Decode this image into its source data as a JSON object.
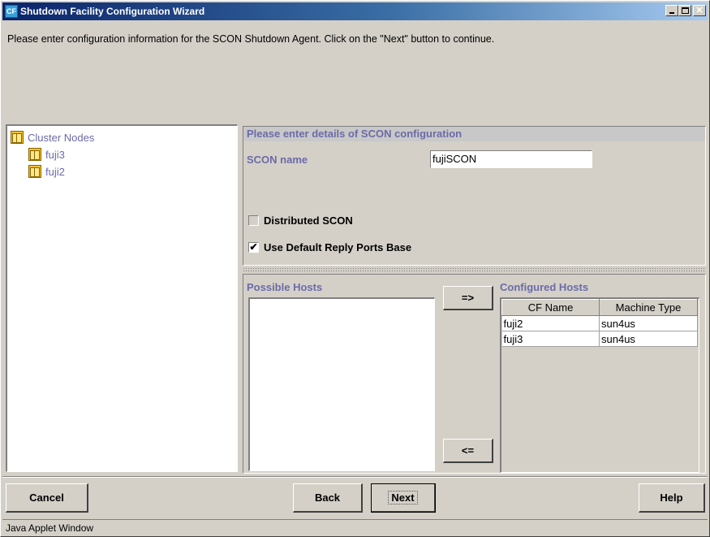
{
  "window": {
    "title": "Shutdown Facility Configuration Wizard",
    "app_icon_text": "CF",
    "minimize_glyph": "_",
    "close_glyph": "✕"
  },
  "instructions": "Please enter configuration information for the SCON Shutdown Agent. Click on the \"Next\" button to continue.",
  "tree": {
    "root_label": "Cluster Nodes",
    "children": [
      "fuji3",
      "fuji2"
    ]
  },
  "scon_config": {
    "header": "Please enter details of SCON configuration",
    "scon_name_label": "SCON name",
    "scon_name_value": "fujiSCON",
    "distributed_label": "Distributed SCON",
    "distributed_checked": false,
    "default_ports_label": "Use Default Reply Ports Base",
    "default_ports_checked": true,
    "check_glyph": "✔"
  },
  "hosts": {
    "possible_label": "Possible Hosts",
    "configured_label": "Configured Hosts",
    "add_button": "=>",
    "remove_button": "<=",
    "columns": [
      "CF Name",
      "Machine Type"
    ],
    "rows": [
      [
        "fuji2",
        "sun4us"
      ],
      [
        "fuji3",
        "sun4us"
      ]
    ]
  },
  "buttons": {
    "cancel": "Cancel",
    "back": "Back",
    "next": "Next",
    "help": "Help"
  },
  "statusbar": "Java Applet Window",
  "colors": {
    "title_gradient_start": "#0a246a",
    "title_gradient_end": "#a6caf0",
    "label_accent": "#6b6ba8",
    "window_bg": "#d4d0c8"
  }
}
